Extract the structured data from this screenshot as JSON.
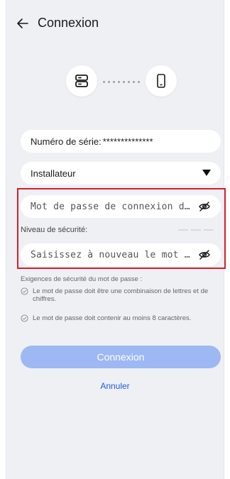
{
  "header": {
    "title": "Connexion"
  },
  "form": {
    "serial_label": "Numéro de série:",
    "serial_value": "**************",
    "role_value": "Installateur",
    "password_placeholder": "Mot de passe de connexion de…",
    "security_label": "Niveau de sécurité:",
    "confirm_placeholder": "Saisissez à nouveau le mot de…"
  },
  "requirements": {
    "title": "Exigences de sécurité du mot de passe :",
    "items": [
      "Le mot de passe doit être une combinaison de lettres et de chiffres.",
      "Le mot de passe doit contenir au moins 8 caractères."
    ]
  },
  "actions": {
    "login_label": "Connexion",
    "cancel_label": "Annuler"
  },
  "colors": {
    "accent": "#1f5fd6",
    "button_disabled": "#9db8f3",
    "highlight": "#d5202a",
    "background": "#eef0f4"
  },
  "icons": [
    "back-arrow-icon",
    "server-icon",
    "phone-icon",
    "dropdown-arrow-icon",
    "eye-off-icon",
    "check-circle-icon"
  ]
}
